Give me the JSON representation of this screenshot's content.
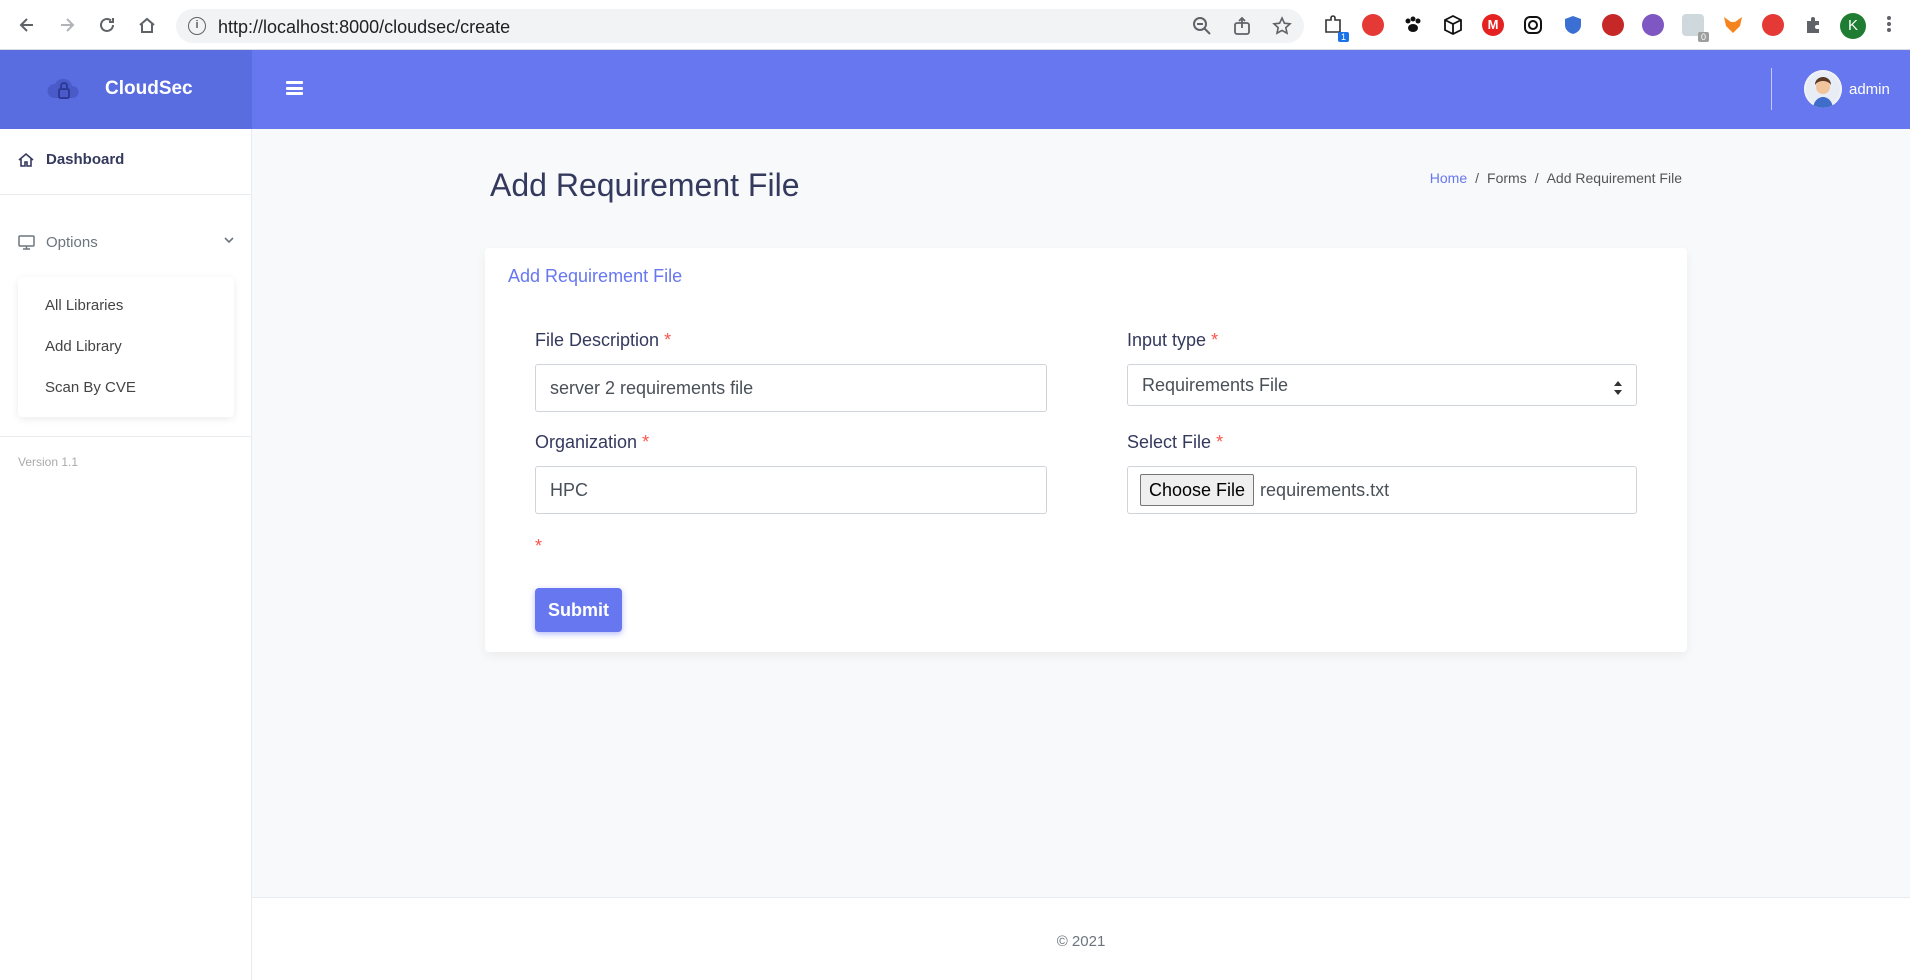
{
  "browser": {
    "url": "http://localhost:8000/cloudsec/create",
    "profile_initial": "K",
    "extension_badge_count": "1",
    "extension_badge_count_2": "0"
  },
  "header": {
    "brand_name": "CloudSec",
    "user_name": "admin",
    "accent_color": "#6777ef"
  },
  "sidebar": {
    "dashboard_label": "Dashboard",
    "options_label": "Options",
    "submenu": [
      {
        "label": "All Libraries"
      },
      {
        "label": "Add Library"
      },
      {
        "label": "Scan By CVE"
      }
    ],
    "version": "Version 1.1"
  },
  "page": {
    "title": "Add Requirement File",
    "breadcrumb": [
      {
        "label": "Home"
      },
      {
        "label": "Forms"
      },
      {
        "label": "Add Requirement File"
      }
    ]
  },
  "form": {
    "card_title": "Add Requirement File",
    "required_mark": "*",
    "file_description": {
      "label": "File Description",
      "value": "server 2 requirements file"
    },
    "input_type": {
      "label": "Input type",
      "value": "Requirements File"
    },
    "organization": {
      "label": "Organization",
      "value": "HPC"
    },
    "select_file": {
      "label": "Select File",
      "button": "Choose File",
      "filename": "requirements.txt"
    },
    "submit_label": "Submit"
  },
  "footer": {
    "copyright": "© 2021"
  }
}
